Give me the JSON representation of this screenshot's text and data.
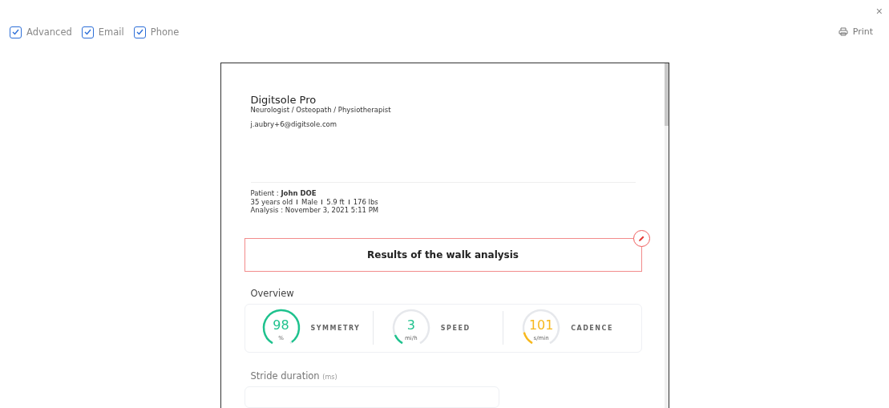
{
  "options": [
    {
      "label": "Advanced",
      "checked": true
    },
    {
      "label": "Email",
      "checked": true
    },
    {
      "label": "Phone",
      "checked": true
    }
  ],
  "close": "×",
  "print": "Print",
  "report": {
    "practitioner": "Digitsole Pro",
    "specialty": "Neurologist / Osteopath / Physiotherapist",
    "email": "j.aubry+6@digitsole.com",
    "patient_label": "Patient : ",
    "patient_name": "John DOE",
    "patient_details": [
      "35 years old",
      "Male",
      "5.9 ft",
      "176 lbs"
    ],
    "analysis": "Analysis : November 3, 2021 5:11 PM",
    "title": "Results of the walk analysis",
    "overview_title": "Overview",
    "metrics": [
      {
        "name": "SYMMETRY",
        "value": "98",
        "unit": "%",
        "level": 0.98,
        "color": "#1fc28e"
      },
      {
        "name": "SPEED",
        "value": "3",
        "unit": "mi/h",
        "level": 0.12,
        "color": "#1fc28e"
      },
      {
        "name": "CADENCE",
        "value": "101",
        "unit": "s/min",
        "level": 0.15,
        "color": "#f7b81e"
      }
    ],
    "stride_title": "Stride duration",
    "stride_unit": "(ms)"
  }
}
